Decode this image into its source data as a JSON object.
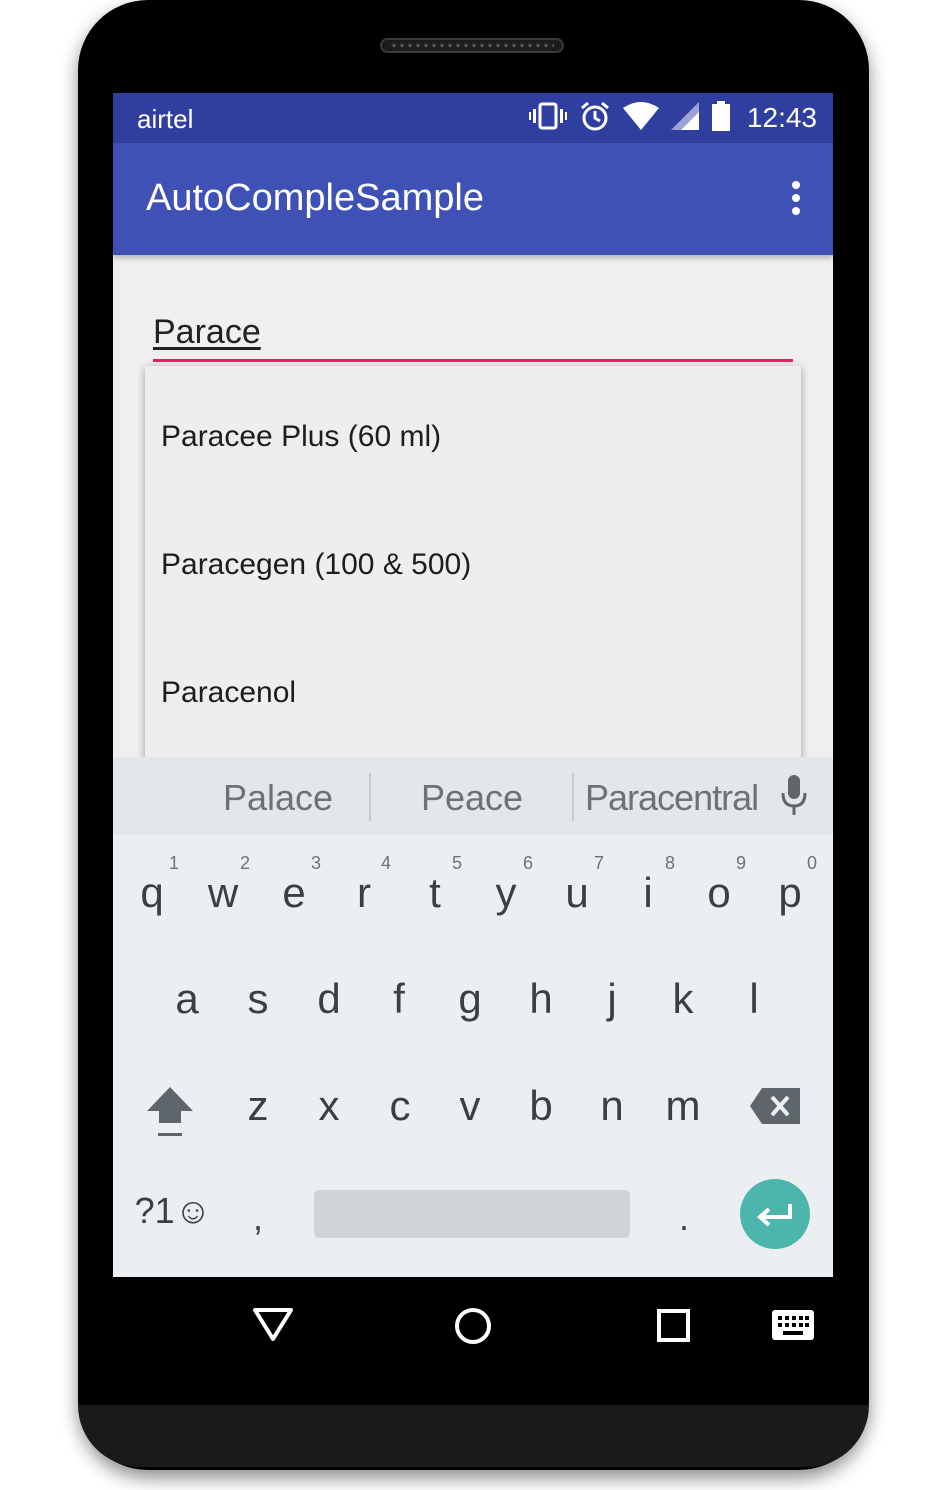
{
  "status_bar": {
    "carrier": "airtel",
    "time": "12:43",
    "icons": [
      "vibrate-icon",
      "alarm-icon",
      "wifi-icon",
      "signal-icon",
      "battery-icon"
    ]
  },
  "app_bar": {
    "title": "AutoCompleSample",
    "menu_icon": "overflow-menu-icon"
  },
  "autocomplete": {
    "input_value": "Parace",
    "underline_color": "#e91e63",
    "suggestions": [
      "Paracee Plus (60 ml)",
      "Paracegen (100 & 500)",
      "Paracenol"
    ]
  },
  "keyboard": {
    "suggestions": [
      "Palace",
      "Peace",
      "Paracentral"
    ],
    "row1": [
      "q",
      "w",
      "e",
      "r",
      "t",
      "y",
      "u",
      "i",
      "o",
      "p"
    ],
    "row1_hints": [
      "1",
      "2",
      "3",
      "4",
      "5",
      "6",
      "7",
      "8",
      "9",
      "0"
    ],
    "row2": [
      "a",
      "s",
      "d",
      "f",
      "g",
      "h",
      "j",
      "k",
      "l"
    ],
    "row3": [
      "z",
      "x",
      "c",
      "v",
      "b",
      "n",
      "m"
    ],
    "symbols_label": "?1☺",
    "comma": ",",
    "period": ".",
    "accent_color": "#4db6ac"
  },
  "colors": {
    "status_bar": "#303f9f",
    "app_bar": "#3f51b5"
  }
}
